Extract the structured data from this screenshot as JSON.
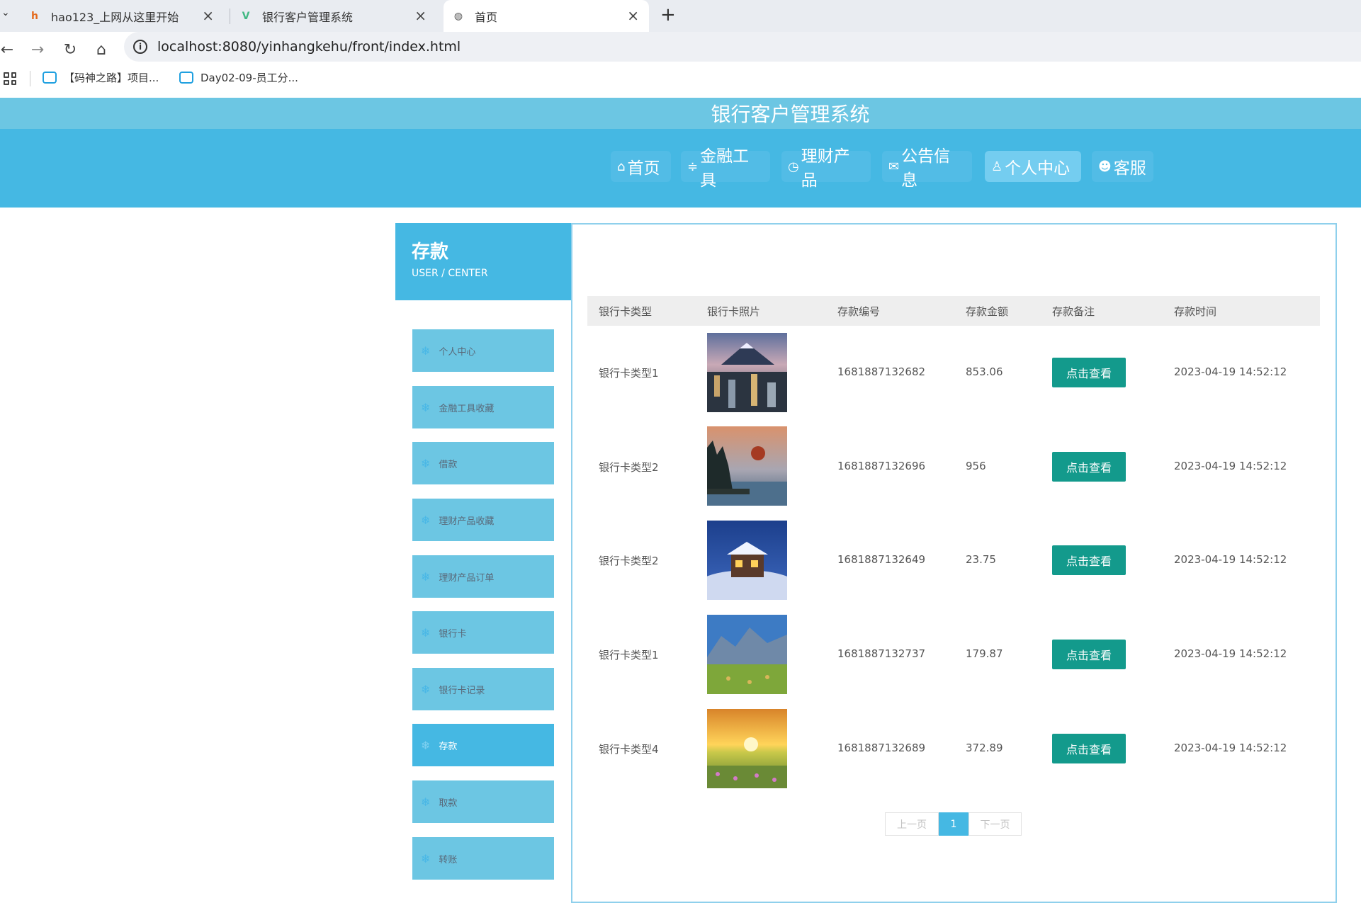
{
  "browser": {
    "tabs": [
      {
        "title": "hao123_上网从这里开始",
        "favicon": "hao123-logo-icon"
      },
      {
        "title": "银行客户管理系统",
        "favicon": "vue-logo-icon"
      },
      {
        "title": "首页",
        "favicon": "globe-icon"
      }
    ],
    "url": "localhost:8080/yinhangkehu/front/index.html",
    "bookmarks": [
      "【码神之路】项目...",
      "Day02-09-员工分..."
    ]
  },
  "site": {
    "title": "银行客户管理系统",
    "nav": [
      {
        "label": "首页",
        "icon": "⌂"
      },
      {
        "label": "金融工具",
        "icon": "≑"
      },
      {
        "label": "理财产品",
        "icon": "◷"
      },
      {
        "label": "公告信息",
        "icon": "✉"
      },
      {
        "label": "个人中心",
        "icon": "♙"
      },
      {
        "label": "客服",
        "icon": "☻"
      }
    ]
  },
  "sidebar": {
    "title": "存款",
    "subtitle": "USER / CENTER",
    "items": [
      "个人中心",
      "金融工具收藏",
      "借款",
      "理财产品收藏",
      "理财产品订单",
      "银行卡",
      "银行卡记录",
      "存款",
      "取款",
      "转账"
    ],
    "active": "存款"
  },
  "table": {
    "headers": [
      "银行卡类型",
      "银行卡照片",
      "存款编号",
      "存款金额",
      "存款备注",
      "存款时间"
    ],
    "rows": [
      {
        "type": "银行卡类型1",
        "photo": "city-mountain-photo",
        "number": "1681887132682",
        "amount": "853.06",
        "action": "点击查看",
        "time": "2023-04-19 14:52:12"
      },
      {
        "type": "银行卡类型2",
        "photo": "lake-moon-photo",
        "number": "1681887132696",
        "amount": "956",
        "action": "点击查看",
        "time": "2023-04-19 14:52:12"
      },
      {
        "type": "银行卡类型2",
        "photo": "snow-cabin-photo",
        "number": "1681887132649",
        "amount": "23.75",
        "action": "点击查看",
        "time": "2023-04-19 14:52:12"
      },
      {
        "type": "银行卡类型1",
        "photo": "mountain-field-photo",
        "number": "1681887132737",
        "amount": "179.87",
        "action": "点击查看",
        "time": "2023-04-19 14:52:12"
      },
      {
        "type": "银行卡类型4",
        "photo": "sunset-flowers-photo",
        "number": "1681887132689",
        "amount": "372.89",
        "action": "点击查看",
        "time": "2023-04-19 14:52:12"
      }
    ]
  },
  "pagination": {
    "prev": "上一页",
    "current": "1",
    "next": "下一页"
  },
  "colors": {
    "header": "#45b8e3",
    "title_bar": "#6cc6e3",
    "button": "#139a8c",
    "sidebar_item": "#6cc6e3"
  }
}
